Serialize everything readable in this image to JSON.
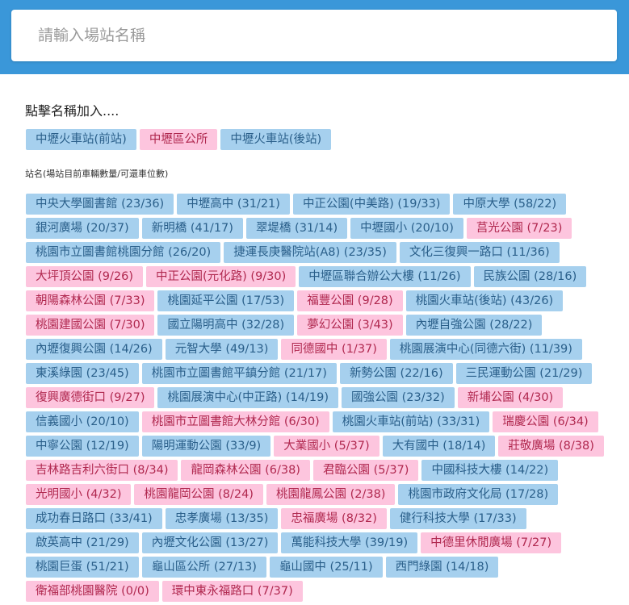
{
  "search": {
    "placeholder": "請輸入場站名稱"
  },
  "hint": "點擊名稱加入....",
  "selected": [
    {
      "label": "中壢火車站(前站)",
      "color": "blue"
    },
    {
      "label": "中壢區公所",
      "color": "pink"
    },
    {
      "label": "中壢火車站(後站)",
      "color": "blue"
    }
  ],
  "subtitle": "站名(場站目前車輛數量/可還車位數)",
  "stations": [
    {
      "label": "中央大學圖書館 (23/36)",
      "color": "blue"
    },
    {
      "label": "中壢高中 (31/21)",
      "color": "blue"
    },
    {
      "label": "中正公園(中美路) (19/33)",
      "color": "blue"
    },
    {
      "label": "中原大學 (58/22)",
      "color": "blue"
    },
    {
      "label": "銀河廣場 (20/37)",
      "color": "blue"
    },
    {
      "label": "新明橋 (41/17)",
      "color": "blue"
    },
    {
      "label": "翠堤橋 (31/14)",
      "color": "blue"
    },
    {
      "label": "中壢國小 (20/10)",
      "color": "blue"
    },
    {
      "label": "莒光公園 (7/23)",
      "color": "pink"
    },
    {
      "label": "桃園市立圖書館桃園分館 (26/20)",
      "color": "blue"
    },
    {
      "label": "捷運長庚醫院站(A8) (23/35)",
      "color": "blue"
    },
    {
      "label": "文化三復興一路口 (11/36)",
      "color": "blue"
    },
    {
      "label": "大坪頂公園 (9/26)",
      "color": "pink"
    },
    {
      "label": "中正公園(元化路) (9/30)",
      "color": "pink"
    },
    {
      "label": "中壢區聯合辦公大樓 (11/26)",
      "color": "blue"
    },
    {
      "label": "民族公園 (28/16)",
      "color": "blue"
    },
    {
      "label": "朝陽森林公園 (7/33)",
      "color": "pink"
    },
    {
      "label": "桃園延平公園 (17/53)",
      "color": "blue"
    },
    {
      "label": "福豐公園 (9/28)",
      "color": "pink"
    },
    {
      "label": "桃園火車站(後站) (43/26)",
      "color": "blue"
    },
    {
      "label": "桃園建國公園 (7/30)",
      "color": "pink"
    },
    {
      "label": "國立陽明高中 (32/28)",
      "color": "blue"
    },
    {
      "label": "夢幻公園 (3/43)",
      "color": "pink"
    },
    {
      "label": "內壢自強公園 (28/22)",
      "color": "blue"
    },
    {
      "label": "內壢復興公園 (14/26)",
      "color": "blue"
    },
    {
      "label": "元智大學 (49/13)",
      "color": "blue"
    },
    {
      "label": "同德國中 (1/37)",
      "color": "pink"
    },
    {
      "label": "桃園展演中心(同德六街) (11/39)",
      "color": "blue"
    },
    {
      "label": "東溪綠園 (23/45)",
      "color": "blue"
    },
    {
      "label": "桃園市立圖書館平鎮分館 (21/17)",
      "color": "blue"
    },
    {
      "label": "新勢公園 (22/16)",
      "color": "blue"
    },
    {
      "label": "三民運動公園 (21/29)",
      "color": "blue"
    },
    {
      "label": "復興廣德街口 (9/27)",
      "color": "pink"
    },
    {
      "label": "桃園展演中心(中正路) (14/19)",
      "color": "blue"
    },
    {
      "label": "國強公園 (23/32)",
      "color": "blue"
    },
    {
      "label": "新埔公園 (4/30)",
      "color": "pink"
    },
    {
      "label": "信義國小 (20/10)",
      "color": "blue"
    },
    {
      "label": "桃園市立圖書館大林分館 (6/30)",
      "color": "pink"
    },
    {
      "label": "桃園火車站(前站) (33/31)",
      "color": "blue"
    },
    {
      "label": "瑞慶公園 (6/34)",
      "color": "pink"
    },
    {
      "label": "中寧公園 (12/19)",
      "color": "blue"
    },
    {
      "label": "陽明運動公園 (33/9)",
      "color": "blue"
    },
    {
      "label": "大業國小 (5/37)",
      "color": "pink"
    },
    {
      "label": "大有國中 (18/14)",
      "color": "blue"
    },
    {
      "label": "莊敬廣場 (8/38)",
      "color": "pink"
    },
    {
      "label": "吉林路吉利六街口 (8/34)",
      "color": "pink"
    },
    {
      "label": "龍岡森林公園 (6/38)",
      "color": "pink"
    },
    {
      "label": "君臨公園 (5/37)",
      "color": "pink"
    },
    {
      "label": "中國科技大樓 (14/22)",
      "color": "blue"
    },
    {
      "label": "光明國小 (4/32)",
      "color": "pink"
    },
    {
      "label": "桃園龍岡公園 (8/24)",
      "color": "pink"
    },
    {
      "label": "桃園龍鳳公園 (2/38)",
      "color": "pink"
    },
    {
      "label": "桃園市政府文化局 (17/28)",
      "color": "blue"
    },
    {
      "label": "成功春日路口 (33/41)",
      "color": "blue"
    },
    {
      "label": "忠孝廣場 (13/35)",
      "color": "blue"
    },
    {
      "label": "忠福廣場 (8/32)",
      "color": "pink"
    },
    {
      "label": "健行科技大學 (17/33)",
      "color": "blue"
    },
    {
      "label": "啟英高中 (21/29)",
      "color": "blue"
    },
    {
      "label": "內壢文化公園 (13/27)",
      "color": "blue"
    },
    {
      "label": "萬能科技大學 (39/19)",
      "color": "blue"
    },
    {
      "label": "中德里休閒廣場 (7/27)",
      "color": "pink"
    },
    {
      "label": "桃園巨蛋 (51/21)",
      "color": "blue"
    },
    {
      "label": "龜山區公所 (27/13)",
      "color": "blue"
    },
    {
      "label": "龜山國中 (25/11)",
      "color": "blue"
    },
    {
      "label": "西門綠園 (14/18)",
      "color": "blue"
    },
    {
      "label": "衛福部桃園醫院 (0/0)",
      "color": "pink"
    },
    {
      "label": "環中東永福路口 (7/37)",
      "color": "pink"
    }
  ]
}
